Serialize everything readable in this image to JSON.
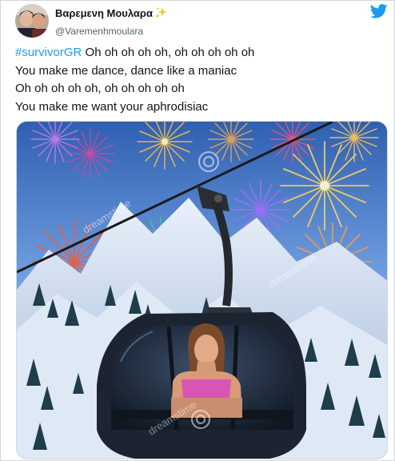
{
  "tweet": {
    "author": {
      "display_name": "Βαρεμενη Μουλαρα",
      "handle": "@Varemenhmoulara",
      "name_emoji": "sparkles-icon"
    },
    "platform_icon": "twitter-bird-icon",
    "text": {
      "hashtag": "#survivorGR",
      "line1_rest": " Oh oh oh oh oh, oh oh oh oh oh",
      "line2": "You make me dance, dance like a maniac",
      "line3": "Oh oh oh oh oh, oh oh oh oh oh",
      "line4": "You make me want your aphrodisiac"
    },
    "media": {
      "watermark": "dreamstime"
    }
  },
  "colors": {
    "link": "#1d9bf0",
    "text": "#0f1419",
    "secondary": "#536471",
    "border": "#cfd9de"
  }
}
